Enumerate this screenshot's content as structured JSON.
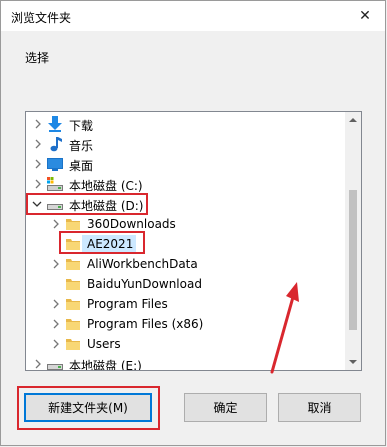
{
  "window": {
    "title": "浏览文件夹",
    "close_glyph": "✕"
  },
  "prompt": "选择",
  "tree": {
    "items": [
      {
        "label": "下载",
        "icon": "download-arrow-icon"
      },
      {
        "label": "音乐",
        "icon": "music-note-icon"
      },
      {
        "label": "桌面",
        "icon": "desktop-icon"
      },
      {
        "label": "本地磁盘 (C:)",
        "icon": "drive-icon"
      },
      {
        "label": "本地磁盘 (D:)",
        "icon": "drive-icon",
        "expanded": true
      },
      {
        "label": "360Downloads",
        "icon": "folder-icon"
      },
      {
        "label": "AE2021",
        "icon": "folder-icon",
        "selected": true
      },
      {
        "label": "AliWorkbenchData",
        "icon": "folder-icon"
      },
      {
        "label": "BaiduYunDownload",
        "icon": "folder-icon"
      },
      {
        "label": "Program Files",
        "icon": "folder-icon"
      },
      {
        "label": "Program Files (x86)",
        "icon": "folder-icon"
      },
      {
        "label": "Users",
        "icon": "folder-icon"
      },
      {
        "label": "本地磁盘 (E:)",
        "icon": "drive-icon"
      }
    ]
  },
  "buttons": {
    "new_folder": "新建文件夹(M)",
    "ok": "确定",
    "cancel": "取消"
  },
  "colors": {
    "annotation_red": "#d9272e",
    "selection": "#cce8ff",
    "folder_yellow": "#f8d775",
    "download_blue": "#1e88e5",
    "focus_blue": "#0078d7"
  }
}
